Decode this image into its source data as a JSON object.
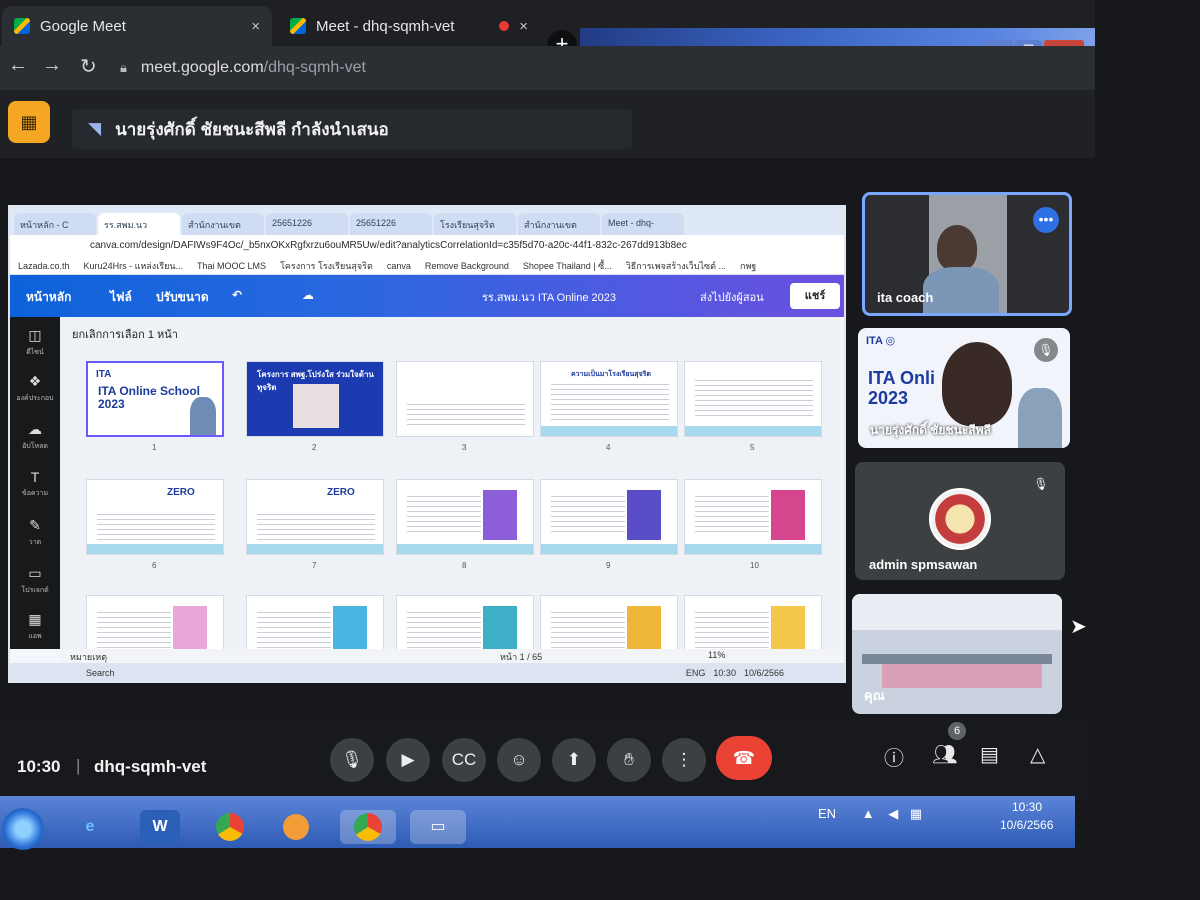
{
  "browser": {
    "tabs": [
      {
        "title": "Google Meet",
        "close": "×"
      },
      {
        "title": "Meet - dhq-sqmh-vet",
        "close": "×"
      }
    ],
    "new_tab": "+",
    "url_host": "meet.google.com",
    "url_path": "/dhq-sqmh-vet"
  },
  "meet": {
    "presenter_banner": "นายรุ่งศักดิ์ ชัยชนะสีพลี กำลังนำเสนอ",
    "time": "10:30",
    "separator": "|",
    "meeting_code": "dhq-sqmh-vet",
    "participant_count": "6",
    "participants": [
      {
        "name": "ita coach"
      },
      {
        "name": "นายรุ่งศักดิ์ ชัยชนะสีพลี"
      },
      {
        "name": "admin spmsawan"
      },
      {
        "name": "คุณ"
      }
    ]
  },
  "shared_screen": {
    "tabs": [
      "หน้าหลัก - C",
      "รร.สพม.นว",
      "สำนักงานเขต",
      "25651226",
      "25651226",
      "โรงเรียนสุจริต",
      "สำนักงานเขต",
      "Meet - dhq-"
    ],
    "url": "canva.com/design/DAFIWs9F4Oc/_b5nxOKxRgfxrzu6ouMR5Uw/edit?analyticsCorrelationId=c35f5d70-a20c-44f1-832c-267dd913b8ec",
    "bookmarks": [
      "Lazada.co.th",
      "Kuru24Hrs - แหล่งเรียน...",
      "Thai MOOC LMS",
      "โครงการ โรงเรียนสุจริต",
      "canva",
      "Remove Background",
      "Shopee Thailand | ซื้...",
      "วิธีการเพจสร้างเว็บไซต์ ...",
      "กพฐ"
    ],
    "canva_menu": [
      "หน้าหลัก",
      "ไฟล์",
      "ปรับขนาด"
    ],
    "canva_title": "รร.สพม.นว ITA Online 2023",
    "publish_label": "ส่งไปยังผู้สอน",
    "share_label": "แชร์",
    "grid_toolbar": "ยกเลิกการเลือก 1 หน้า",
    "sidebar": [
      "ดีไซน์",
      "องค์ประกอบ",
      "อัปโหลด",
      "ข้อความ",
      "วาด",
      "โปรเจกต์",
      "แอพ"
    ],
    "slides": [
      {
        "num": "1",
        "title": "ITA Online School 2023"
      },
      {
        "num": "2",
        "title": "โครงการ สพฐ.โปร่งใส ร่วมใจต้านทุจริต"
      },
      {
        "num": "3",
        "title": ""
      },
      {
        "num": "4",
        "title": "ความเป็นมาโรงเรียนสุจริต"
      },
      {
        "num": "5",
        "title": ""
      },
      {
        "num": "6",
        "title": "ZERO"
      },
      {
        "num": "7",
        "title": "ZERO"
      },
      {
        "num": "8",
        "title": ""
      },
      {
        "num": "9",
        "title": ""
      },
      {
        "num": "10",
        "title": ""
      }
    ],
    "notes_label": "หมายเหตุ",
    "page_indicator": "หน้า 1 / 65",
    "zoom": "11%",
    "inner_taskbar_search": "Search",
    "inner_clock": "10:30",
    "inner_date": "10/6/2566",
    "inner_lang": "ENG"
  },
  "windows": {
    "tray_lang": "EN",
    "clock_time": "10:30",
    "clock_date": "10/6/2566"
  },
  "icons": {
    "present": "screen-share-off-icon",
    "mic": "microphone-icon",
    "camera": "camera-icon",
    "captions": "captions-icon",
    "emoji": "emoji-icon",
    "share": "present-screen-icon",
    "hand": "raise-hand-icon",
    "more": "more-options-icon",
    "end": "end-call-icon",
    "info": "info-icon",
    "people": "people-icon",
    "chat": "chat-icon",
    "activities": "activities-icon"
  },
  "colors": {
    "end_call": "#ea4335",
    "active_speaker": "#7aa7ff",
    "present_icon": "#f5a623",
    "canva_bar": "#0d62d9"
  }
}
